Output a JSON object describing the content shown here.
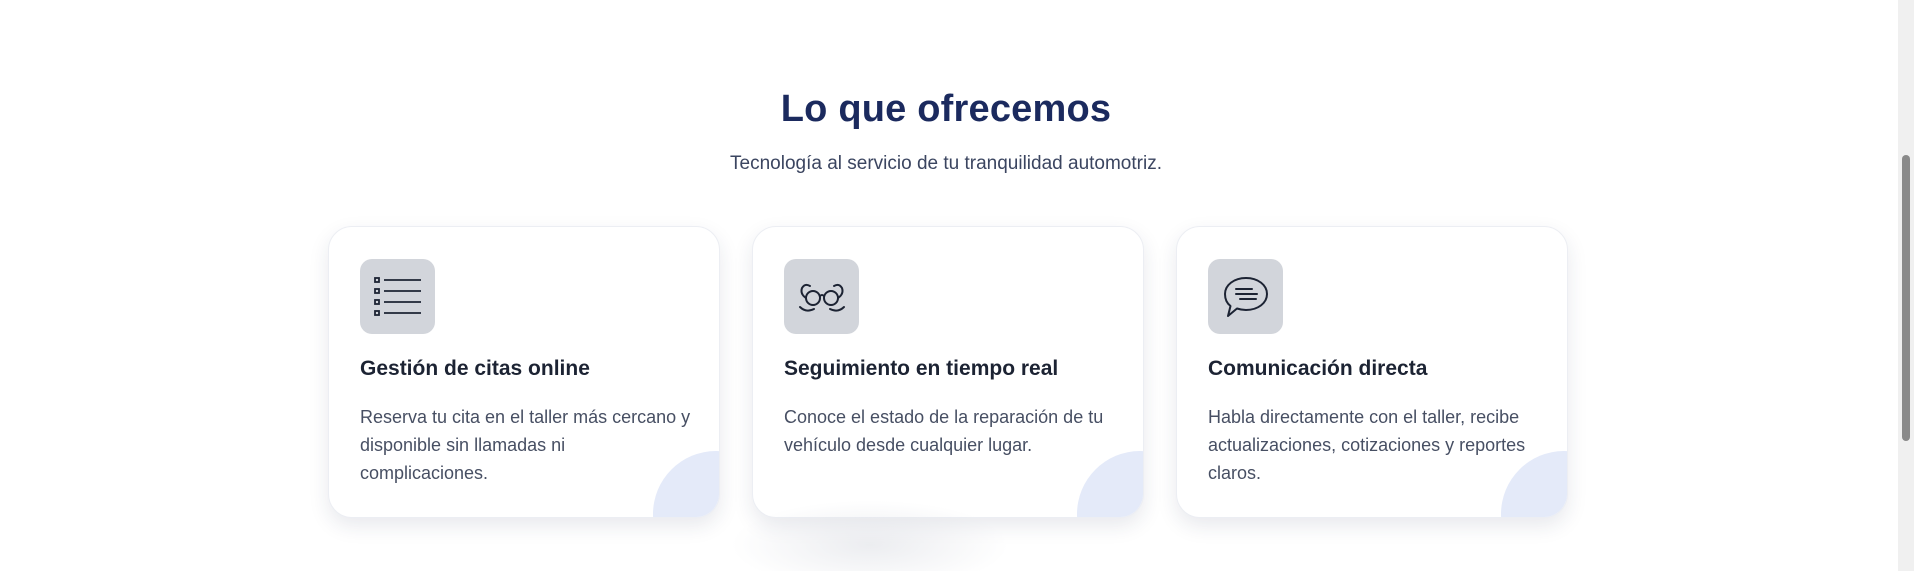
{
  "section": {
    "title": "Lo que ofrecemos",
    "subtitle": "Tecnología al servicio de tu tranquilidad automotriz."
  },
  "cards": [
    {
      "icon": "checklist-icon",
      "title": "Gestión de citas online",
      "text": "Reserva tu cita en el taller más cercano y disponible sin llamadas ni complicaciones."
    },
    {
      "icon": "binoculars-icon",
      "title": "Seguimiento en tiempo real",
      "text": "Conoce el estado de la reparación de tu vehículo desde cualquier lugar."
    },
    {
      "icon": "chat-bubble-icon",
      "title": "Comunicación directa",
      "text": "Habla directamente con el taller, recibe actualizaciones, cotizaciones y reportes claros."
    }
  ],
  "colors": {
    "title": "#1b2a5e",
    "icon_bg": "#d2d5db",
    "card_accent": "#e4eaf9"
  }
}
